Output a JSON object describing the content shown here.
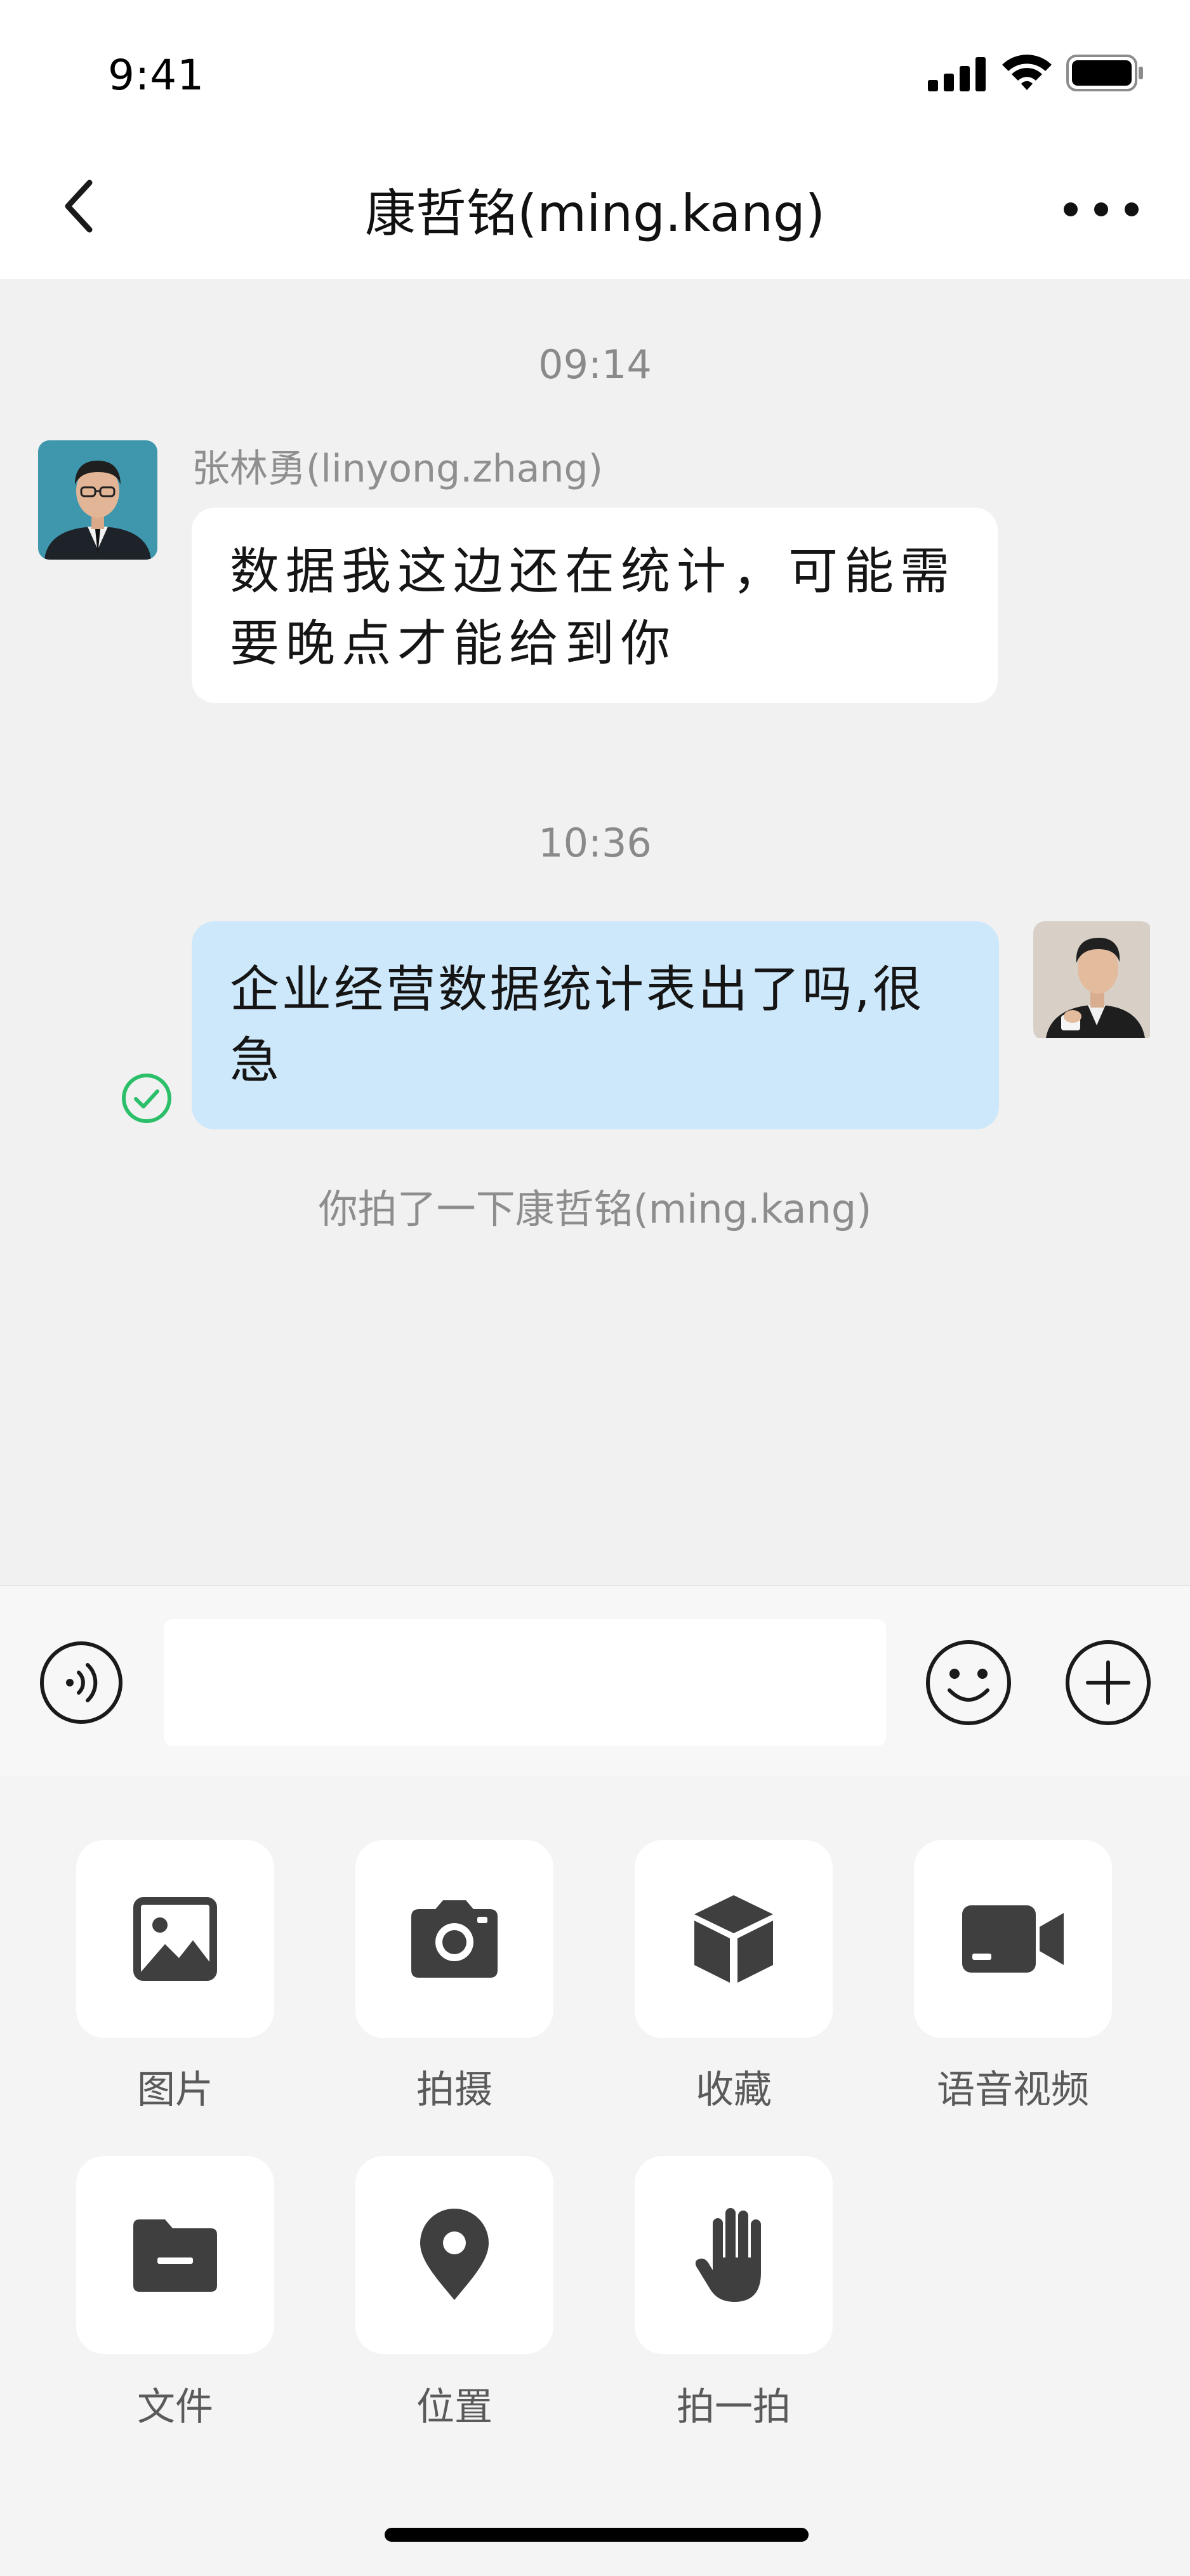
{
  "status_bar": {
    "time": "9:41",
    "icons": [
      "signal-icon",
      "wifi-icon",
      "battery-icon"
    ]
  },
  "nav": {
    "title": "康哲铭(ming.kang)",
    "back_icon": "chevron-left-icon",
    "more_icon": "more-dots-icon"
  },
  "chat": {
    "messages": [
      {
        "timestamp": "09:14",
        "direction": "received",
        "sender": "张林勇(linyong.zhang)",
        "lines": [
          "数据我这边还在统计，可能需",
          "要晚点才能给到你"
        ]
      },
      {
        "timestamp": "10:36",
        "direction": "sent",
        "lines": [
          "企业经营数据统计表出了吗,很",
          "急"
        ],
        "status_icon": "read-check-icon"
      }
    ],
    "system_notice": "你拍了一下康哲铭(ming.kang)"
  },
  "input_bar": {
    "voice_icon": "voice-icon",
    "input_value": "",
    "emoji_icon": "emoji-icon",
    "plus_icon": "plus-icon"
  },
  "panel": {
    "items": [
      {
        "label": "图片",
        "icon": "image-icon"
      },
      {
        "label": "拍摄",
        "icon": "camera-icon"
      },
      {
        "label": "收藏",
        "icon": "favorites-box-icon"
      },
      {
        "label": "语音视频",
        "icon": "video-call-icon"
      },
      {
        "label": "文件",
        "icon": "folder-icon"
      },
      {
        "label": "位置",
        "icon": "location-pin-icon"
      },
      {
        "label": "拍一拍",
        "icon": "hand-pat-icon"
      }
    ]
  },
  "colors": {
    "background": "#f1f1f1",
    "sent_bubble": "#cde8fb",
    "received_bubble": "#ffffff",
    "read_check": "#2bbf6a",
    "icon_dark": "#3f3f3f"
  }
}
